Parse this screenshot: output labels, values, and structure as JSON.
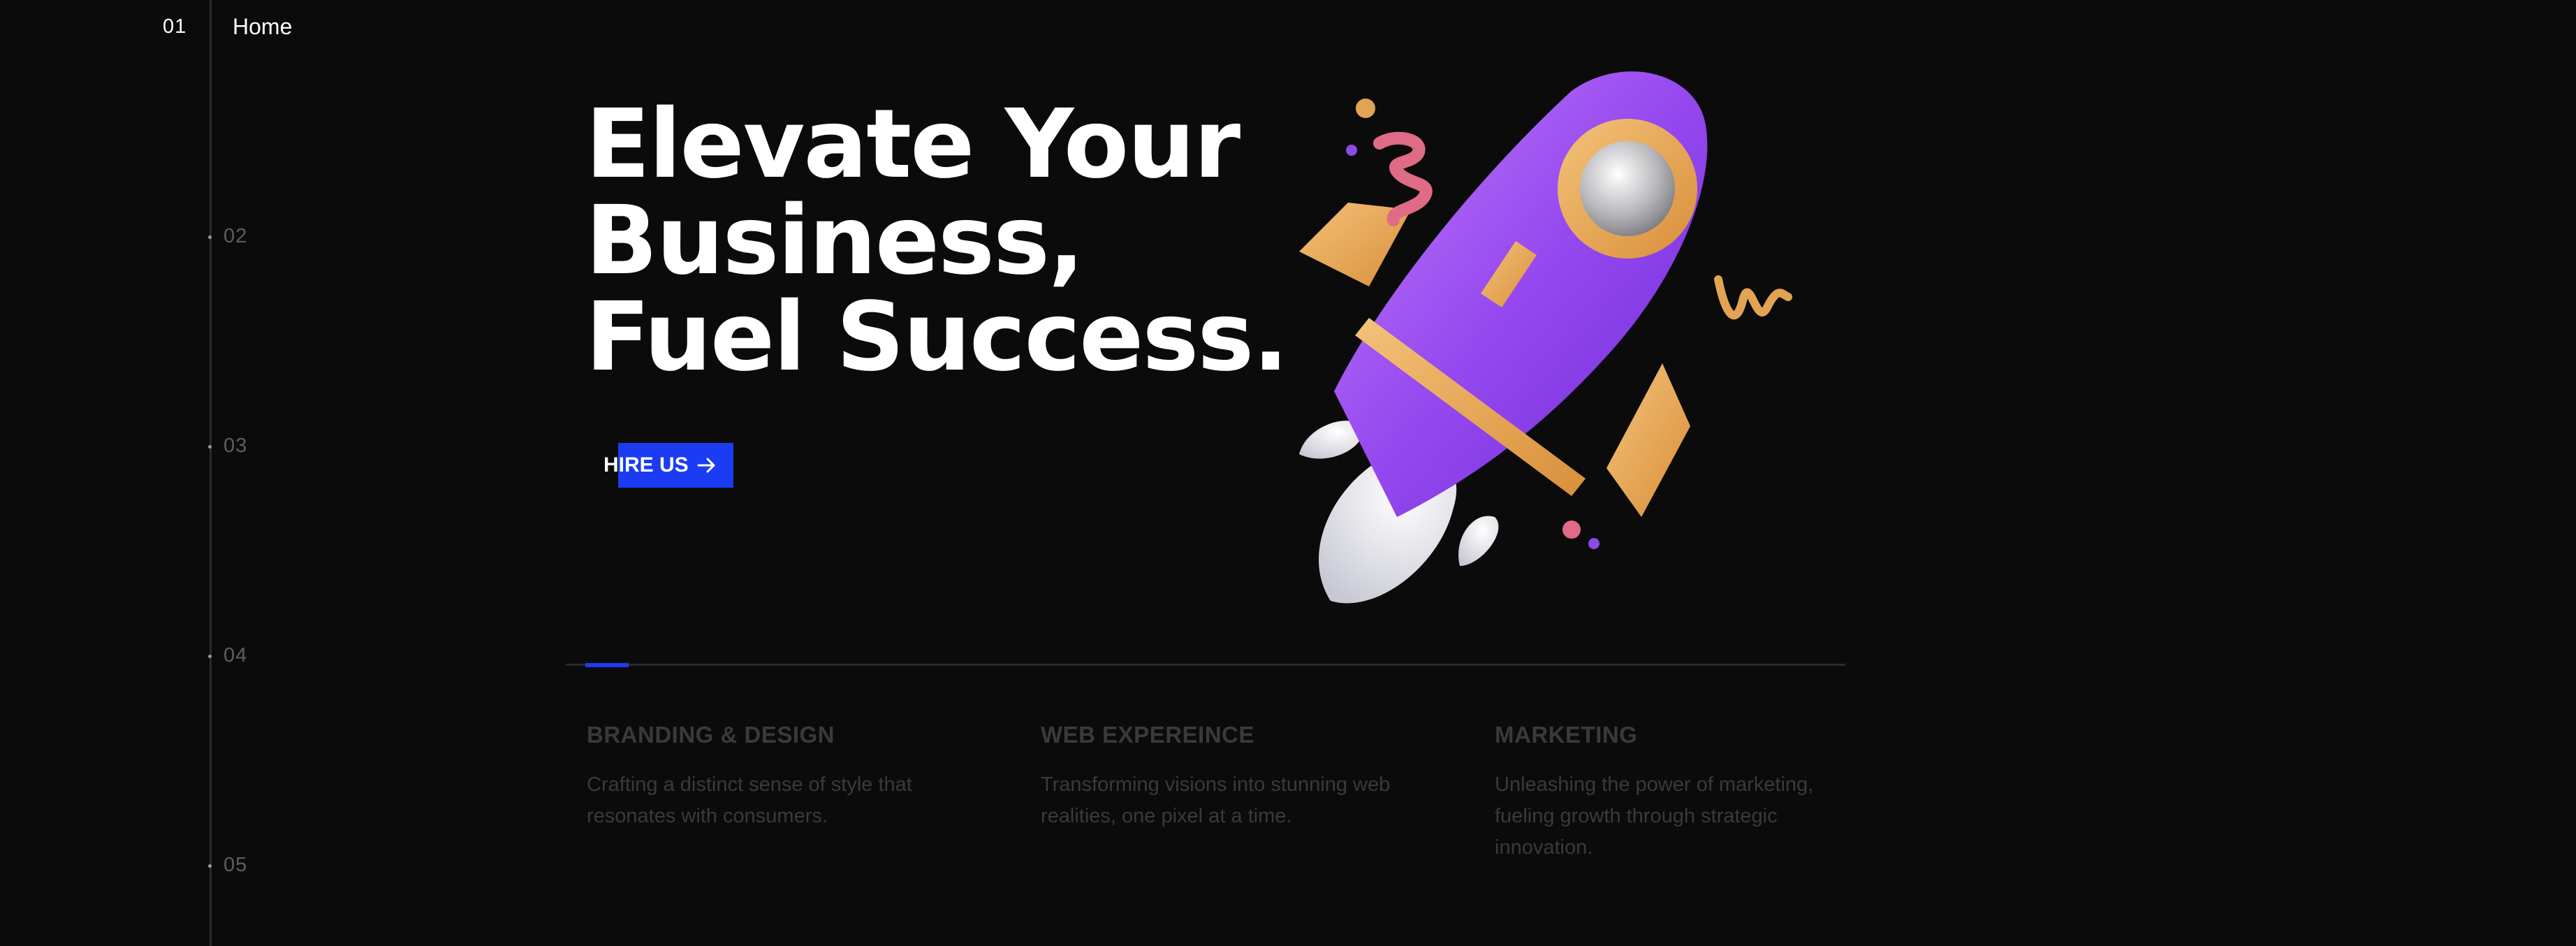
{
  "nav": {
    "items": [
      {
        "num": "01",
        "label": "Home",
        "active": true
      },
      {
        "num": "02"
      },
      {
        "num": "03"
      },
      {
        "num": "04"
      },
      {
        "num": "05"
      }
    ]
  },
  "hero": {
    "title_lines": [
      "Elevate Your",
      "Business,",
      "Fuel Success."
    ],
    "cta_label": "HIRE US",
    "cta_icon": "arrow-right-icon",
    "accent_color": "#1b3cf2",
    "illustration": "rocket-illustration"
  },
  "services": [
    {
      "title": "BRANDING & DESIGN",
      "desc": "Crafting a distinct sense of style that resonates with consumers."
    },
    {
      "title": "WEB EXPEREINCE",
      "desc": "Transforming visions into stunning web realities, one pixel at a time."
    },
    {
      "title": "MARKETING",
      "desc": "Unleashing the power of marketing, fueling growth through strategic innovation."
    }
  ],
  "slider": {
    "active_index": 1,
    "count": 3
  }
}
